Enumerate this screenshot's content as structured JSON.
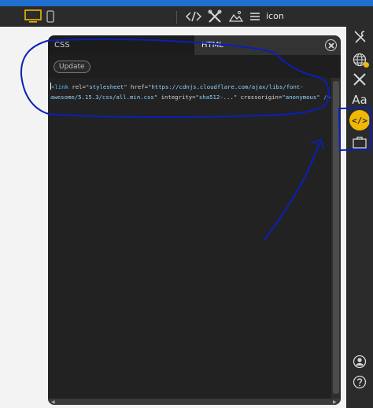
{
  "toolbar": {
    "menu_label": "icon",
    "icons": [
      "monitor-icon",
      "mobile-icon",
      "code-icon",
      "tools-icon",
      "image-icon",
      "menu-icon"
    ]
  },
  "editor": {
    "tabs": [
      {
        "label": "CSS"
      },
      {
        "label": "HTML"
      }
    ],
    "update_label": "Update",
    "code_lines": [
      {
        "tag_open": "<link",
        "attr_rel": " rel=",
        "val_rel": "\"stylesheet\"",
        "attr_href": " href=",
        "val_href": "\"https://cdnjs.cloudflare.com/ajax/libs/font-"
      },
      {
        "val_href_cont": "awesome/5.15.3/css/all.min.css\"",
        "attr_integrity": " integrity=",
        "val_integrity": "\"sha512-...\"",
        "attr_cross": " crossorigin=",
        "val_cross": "\"anonymous\"",
        "tag_close": " />"
      }
    ]
  },
  "sidebar": {
    "font_label": "Aa",
    "code_label": "</>",
    "icons": [
      "globe-icon",
      "tools-icon",
      "font-icon",
      "code-icon",
      "briefcase-icon",
      "user-icon",
      "help-icon"
    ]
  },
  "colors": {
    "accent": "#f2b705",
    "topbar": "#1f6fd1",
    "annotation": "#0a1fb8"
  }
}
